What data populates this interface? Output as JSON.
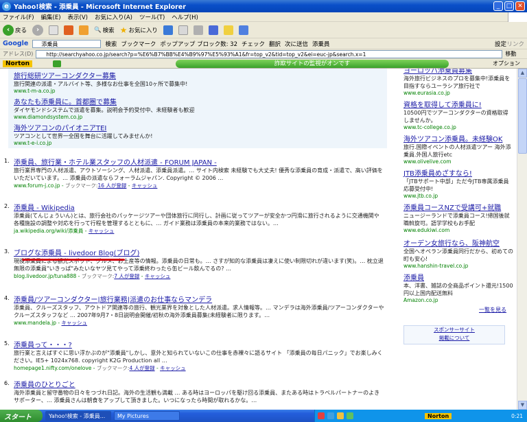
{
  "window": {
    "title": "Yahoo!検索 - 添乗員 - Microsoft Internet Explorer"
  },
  "menu": [
    "ファイル(F)",
    "編集(E)",
    "表示(V)",
    "お気に入り(A)",
    "ツール(T)",
    "ヘルプ(H)"
  ],
  "toolbar": {
    "back": "戻る",
    "search": "検索",
    "favorites": "お気に入り"
  },
  "google_bar": {
    "logo": "Google",
    "query": "添乗員",
    "search_btn": "検索",
    "bookmark": "ブックマーク",
    "popup": "ポップアップ ブロック数: 32",
    "check": "チェック",
    "translate": "翻訳",
    "next": "次に送信",
    "settings": "設定",
    "link": "リンク",
    "highlight": "添乗員"
  },
  "address": {
    "label": "アドレス(D)",
    "url": "http://searchyahoo.co.jp/search?p=%E6%B7%BB%E4%B9%97%E5%93%A1&fr=top_v2&tid=top_v2&ei=euc-jp&search.x=1",
    "go": "移動"
  },
  "norton": {
    "label": "Norton",
    "status": "詐欺サイトの監視がオンです",
    "options": "オプション"
  },
  "ads": [
    {
      "title": "旅行総研ツアーコンダクター募集",
      "desc": "旅行関連の派遣・アルバイト等、多様なお仕事を全国10ヶ所で募集中!",
      "url": "www.t-m-a.co.jp"
    },
    {
      "title": "あなたも添乗員に。首都圏で募集",
      "desc": "ダイヤモンドシステムで派遣を募集。説明会予約受付中、未経験者も歓迎",
      "url": "www.diamondsystem.co.jp"
    },
    {
      "title": "海外ツアコンのパイオニアTEI",
      "desc": "ツアコンとして世界一全国を舞台に活躍してみませんか!",
      "url": "www.t-e-i.co.jp"
    }
  ],
  "results": [
    {
      "num": "1.",
      "title": "添乗員、旅行業・ホテル業スタッフの人材派遣 - FORUM JAPAN -",
      "desc": "旅行業界専門の人材派遣、アウトソーシング、人材派遣、添乗員派遣。… サイト内検索 未経験でも大丈夫! 優秀な添乗員の育成・派遣で、高い評価をいただいています。… 添乗員の派遣ならフォーラムジャパン. Copyright © 2006 …",
      "url": "www.forum-j.co.jp",
      "meta1": "ブックマーク:",
      "meta2": "16 人が登録",
      "meta3": "キャッシュ"
    },
    {
      "num": "2.",
      "title": "添乗員 - Wikipedia",
      "desc": "添乗員(てんじょういん)とは、旅行会社のパッケージツアーや団体旅行に同行し、計画に従ってツアーが安全かつ円滑に旅行されるように交通機関や各種施設の調整や対応を行って行程を管理するとともに、… ガイド業務は添乗員の本来的業務ではない。…",
      "url": "ja.wikipedia.org/wiki/添乗員",
      "meta1": "",
      "meta2": "",
      "meta3": "キャッシュ"
    },
    {
      "num": "3.",
      "title": "ブログな添乗員 - livedoor Blog(ブログ)",
      "desc": "現役添乗員による観光スポット、グルメ、お土産等の情報。添乗員の日常も。… さすが知的な添乗員は凄えに使い制限切れが違います(笑)。… 枕立退無限の添乗員\"いきっぱ\"みたいなヤツ見てやって添乗終わったら缶ビール飲んでるの? …",
      "url": "blog.livedoor.jp/tuna888",
      "meta1": "ブックマーク:",
      "meta2": "7 人が登録",
      "meta3": "キャッシュ"
    },
    {
      "num": "4.",
      "title": "添乗員/ツアーコンダクター|旅行業務|派遣のお仕事ならマンデラ",
      "desc": "添乗員、クルーズスタッフ、アウトドア関連等の旅行、観光業界を対象とした人材派遣。求人情報等。… マンデラは海外添乗員/ツアーコンダクターやクルーズスタッフなど … 2007年9月7・8日説明会開催/初秋の海外添乗員募集(未経験者に限ります。…",
      "url": "www.mandela.jp",
      "meta1": "",
      "meta2": "",
      "meta3": "キャッシュ"
    },
    {
      "num": "5.",
      "title": "添乗員って・・・?",
      "desc": "旅行業と言えばすぐに思い浮かぶのが\"添乗員\"しかし、意外と知られていないこの仕事を赤裸々に語るサイト 「添乗員の毎日パニック」でお楽しみください。IE5+ 1024x768. copyright K2G Production all …",
      "url": "homepage1.nifty.com/onelove",
      "meta1": "ブックマーク:",
      "meta2": "4 人が登録",
      "meta3": "キャッシュ"
    },
    {
      "num": "6.",
      "title": "添乗員のひとりごと",
      "desc": "海外添乗員と留守番物の日々をつづれ日記。海外の生活観も満載 … ある時はヨーロッパを駆け回る添乗員、またある時はトラベルパートナーのよきサポーター、… 添乗員さんは朝食をアップして頂きました。いつになったら時間が取れるかな。…",
      "url": "",
      "meta1": "",
      "meta2": "",
      "meta3": ""
    }
  ],
  "right_ads": [
    {
      "title": "ヨーロッパ添乗員募集",
      "desc": "海外旅行ビジネスのプロを募集中!添乗員を目指すならユーラシア旅行社で",
      "url": "www.eurasia.co.jp"
    },
    {
      "title": "資格を取得して添乗員に!",
      "desc": "10500円でツアーコンダクターの資格取得しませんか。",
      "url": "www.tc-college.co.jp"
    },
    {
      "title": "海外ツアコン添乗員。未経験OK",
      "desc": "旅行.国際イベントの人材派遣ツアー 海外添乗員.外国人旅行etc",
      "url": "www.olivelive.com"
    },
    {
      "title": "JTB添乗員めざすなら!",
      "desc": "「JTBサポート中部」ただ今JTB専属添乗員応募受付中!",
      "url": "www.jtb.co.jp"
    },
    {
      "title": "添乗員コースNZで受講可+就職",
      "desc": "ニュージーランドで添乗員コース!帰国後就職斡旋可。語学学校もお手配",
      "url": "www.edukiwi.com"
    },
    {
      "title": "オーデン女旅行なら、阪神航空",
      "desc": "全国へオペラン添乗員同行だから、初めての町も安心!",
      "url": "www.hanshin-travel.co.jp"
    },
    {
      "title": "添乗員",
      "desc": "本、洋書、雑誌の全商品ポイント還元!1500円以上国内配送無料",
      "url": "Amazon.co.jp"
    }
  ],
  "right_more": "一覧を見る",
  "sponsor": {
    "line1": "スポンサーサイト",
    "line2": "掲載について"
  },
  "taskbar": {
    "start": "スタート",
    "task1": "Yahoo!検索 - 添乗員...",
    "task2": "My Pictures",
    "tray_norton": "Norton",
    "clock": "0:21"
  }
}
